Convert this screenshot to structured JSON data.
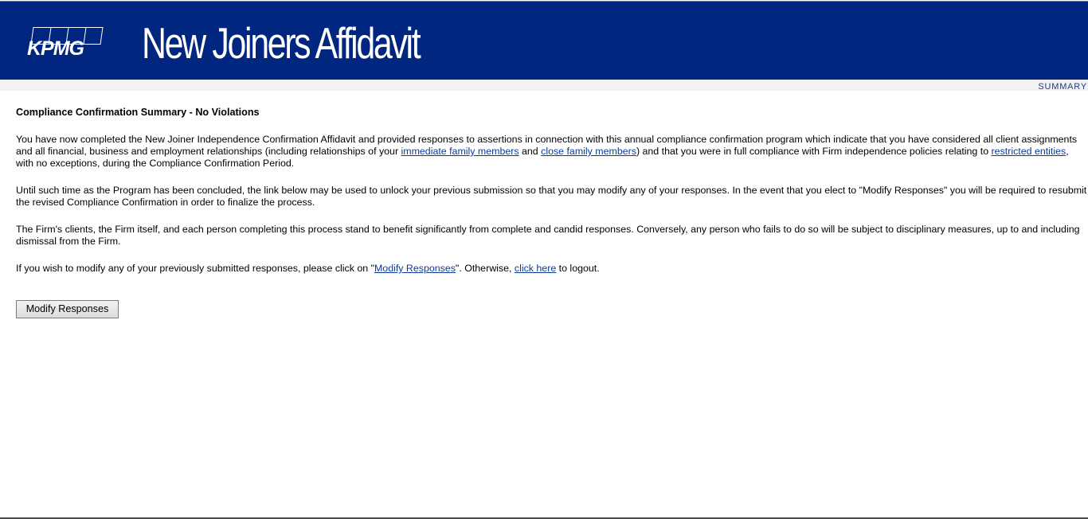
{
  "header": {
    "logo_text": "KPMG",
    "title": "New Joiners Affidavit"
  },
  "nav": {
    "summary_label": "SUMMARY"
  },
  "main": {
    "heading": "Compliance Confirmation Summary - No Violations",
    "paragraph1": {
      "part1": "You have now completed the New Joiner Independence Confirmation Affidavit and provided responses to assertions in connection with this annual compliance confirmation program which indicate that you have considered all client assignments and all financial, business and employment relationships (including relationships of your ",
      "link1": "immediate family members",
      "part2": " and ",
      "link2": "close family members",
      "part3": ") and that you were in full compliance with Firm independence policies relating to ",
      "link3": "restricted entities",
      "part4": ", with no exceptions, during the Compliance Confirmation Period."
    },
    "paragraph2": "Until such time as the Program has been concluded, the link below may be used to unlock your previous submission so that you may modify any of your responses. In the event that you elect to \"Modify Responses\" you will be required to resubmit the revised Compliance Confirmation in order to finalize the process.",
    "paragraph3": "The Firm's clients, the Firm itself, and each person completing this process stand to benefit significantly from complete and candid responses. Conversely, any person who fails to do so will be subject to disciplinary measures, up to and including dismissal from the Firm.",
    "paragraph4": {
      "part1": "If you wish to modify any of your previously submitted responses, please click on \"",
      "link1": "Modify Responses",
      "part2": "\". Otherwise, ",
      "link2": "click here",
      "part3": " to logout."
    },
    "modify_button_label": "Modify Responses"
  },
  "colors": {
    "header_bg": "#00267f",
    "link": "#0b3b9a",
    "summary_link": "#1d3b8a"
  }
}
